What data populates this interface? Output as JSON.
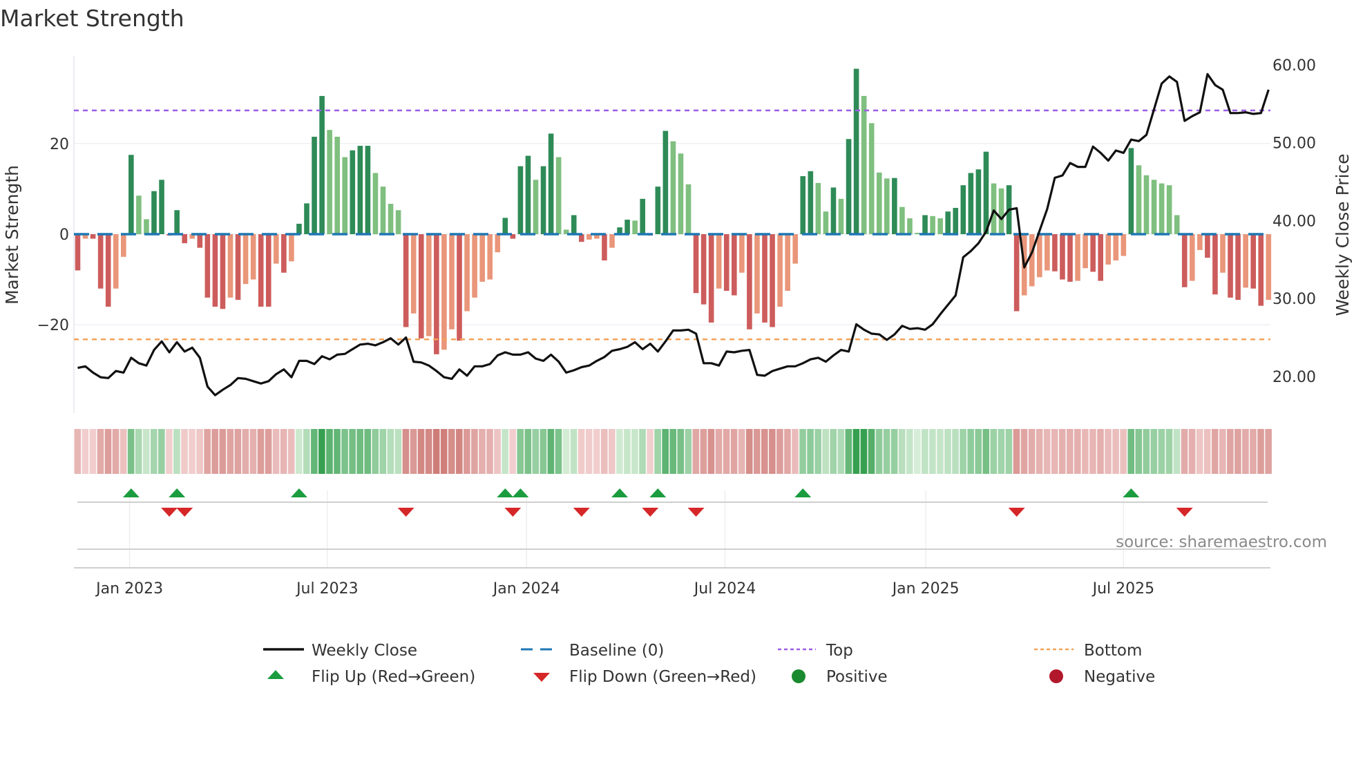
{
  "chart_data": {
    "type": "bar",
    "title": "Market Strength",
    "ylabel": "Market Strength",
    "y2label": "Weekly Close Price",
    "x_unit": "week index (weekly bars)",
    "ylim": [
      -39,
      40
    ],
    "y2lim": [
      15,
      65
    ],
    "yticks": [
      {
        "v": 20,
        "label": "20"
      },
      {
        "v": 0,
        "label": "0"
      },
      {
        "v": -20,
        "label": "−20"
      }
    ],
    "y2ticks": [
      {
        "v": 60,
        "label": "60.00"
      },
      {
        "v": 50,
        "label": "50.00"
      },
      {
        "v": 40,
        "label": "40.00"
      },
      {
        "v": 30,
        "label": "30.00"
      },
      {
        "v": 20,
        "label": "20.00"
      }
    ],
    "xticks": [
      {
        "w": 6.8,
        "label": "Jan 2023"
      },
      {
        "w": 32.7,
        "label": "Jul 2023"
      },
      {
        "w": 58.8,
        "label": "Jan 2024"
      },
      {
        "w": 84.8,
        "label": "Jul 2024"
      },
      {
        "w": 111.1,
        "label": "Jan 2025"
      },
      {
        "w": 137.0,
        "label": "Jul 2025"
      }
    ],
    "top_level": 27.3,
    "bottom_level": -23.2,
    "strength": [
      -8,
      -1,
      -1,
      -12,
      -16,
      -12,
      -5,
      17.5,
      8.5,
      3.3,
      9.5,
      12,
      -0.3,
      5.3,
      -2,
      -1,
      -3,
      -14,
      -16,
      -16.5,
      -14,
      -14.5,
      -11,
      -10,
      -16,
      -16,
      -6.5,
      -8.5,
      -6,
      2.3,
      6.8,
      21.5,
      30.5,
      23,
      21.5,
      17,
      18.5,
      19.5,
      19.5,
      13.5,
      10.5,
      6.7,
      5.3,
      -20.5,
      -17.5,
      -23,
      -22.5,
      -26.5,
      -25.5,
      -21,
      -23.5,
      -17,
      -14,
      -10.5,
      -10,
      -4,
      3.6,
      -1,
      15,
      17.3,
      12,
      15,
      22.2,
      17,
      1,
      4.2,
      -1.7,
      -1.2,
      -1,
      -5.8,
      -3,
      1.5,
      3.2,
      3,
      7.8,
      -0.3,
      10.5,
      22.8,
      20.5,
      17.8,
      11,
      -13,
      -15.5,
      -19.5,
      -12,
      -12.5,
      -13.5,
      -8.5,
      -21,
      -17.5,
      -19.5,
      -20.5,
      -16,
      -12.5,
      -6.5,
      12.8,
      13.9,
      11.3,
      5,
      10.3,
      7.8,
      21,
      36.5,
      30.5,
      24.5,
      13.6,
      12.3,
      12.4,
      6,
      3.5,
      0.3,
      4.2,
      4,
      3.5,
      5,
      5.8,
      10.8,
      13.5,
      14.3,
      18.2,
      11.2,
      10.1,
      10.8,
      -17,
      -13.5,
      -11.5,
      -9.5,
      -8,
      -8.2,
      -10,
      -10.5,
      -10.3,
      -7.5,
      -8.3,
      -10.3,
      -6.7,
      -5.8,
      -4.8,
      19,
      15.2,
      13,
      12,
      11.2,
      10.8,
      4.2,
      -11.7,
      -10.3,
      -3.5,
      -5.2,
      -13.3,
      -8.5,
      -14,
      -14.5,
      -11.8,
      -12,
      -15.8,
      -14.5
    ],
    "weekly_close": [
      21.1,
      21.3,
      20.5,
      19.9,
      19.8,
      20.7,
      20.5,
      22.4,
      21.7,
      21.4,
      23.4,
      24.5,
      23.1,
      24.4,
      23.2,
      23.7,
      22.4,
      18.7,
      17.6,
      18.3,
      18.9,
      19.8,
      19.7,
      19.4,
      19.1,
      19.4,
      20.3,
      20.9,
      19.9,
      22.0,
      22.0,
      21.6,
      22.6,
      22.2,
      22.8,
      22.9,
      23.5,
      24.1,
      24.2,
      24.0,
      24.4,
      24.9,
      24.1,
      25.0,
      21.9,
      21.8,
      21.4,
      20.7,
      19.9,
      19.7,
      20.9,
      20.1,
      21.3,
      21.3,
      21.6,
      22.7,
      23.1,
      22.8,
      22.8,
      23.1,
      22.3,
      22.0,
      22.8,
      21.9,
      20.5,
      20.8,
      21.2,
      21.4,
      22.0,
      22.5,
      23.3,
      23.5,
      23.8,
      24.4,
      23.5,
      24.2,
      23.2,
      24.5,
      25.9,
      25.9,
      26.0,
      25.5,
      21.7,
      21.7,
      21.4,
      23.2,
      23.1,
      23.3,
      23.4,
      20.2,
      20.1,
      20.7,
      21.0,
      21.3,
      21.3,
      21.7,
      22.2,
      22.4,
      21.9,
      22.7,
      23.4,
      23.2,
      26.7,
      26.0,
      25.5,
      25.4,
      24.7,
      25.4,
      26.5,
      26.1,
      26.2,
      26.0,
      26.7,
      28.0,
      29.2,
      30.4,
      35.3,
      36.1,
      37.1,
      38.6,
      41.3,
      40.2,
      41.4,
      41.6,
      34.0,
      35.9,
      38.7,
      41.5,
      45.5,
      45.8,
      47.4,
      46.9,
      46.9,
      49.5,
      48.7,
      47.7,
      49.0,
      48.7,
      50.4,
      50.2,
      51.0,
      54.3,
      57.6,
      58.5,
      57.8,
      52.8,
      53.4,
      53.9,
      58.8,
      57.4,
      56.8,
      53.8,
      53.8,
      53.9,
      53.7,
      53.8,
      56.8
    ],
    "flip_up_weeks": [
      7,
      13,
      29,
      56,
      58,
      71,
      76,
      95,
      138
    ],
    "flip_down_weeks": [
      12,
      14,
      43,
      57,
      66,
      75,
      81,
      123,
      145
    ],
    "legend": [
      {
        "label": "Weekly Close",
        "kind": "line"
      },
      {
        "label": "Baseline (0)",
        "kind": "dash"
      },
      {
        "label": "Top",
        "kind": "dot"
      },
      {
        "label": "Bottom",
        "kind": "dot"
      },
      {
        "label": "Flip Up (Red→Green)",
        "kind": "triangle-up"
      },
      {
        "label": "Flip Down (Green→Red)",
        "kind": "triangle-down"
      },
      {
        "label": "Positive",
        "kind": "circle"
      },
      {
        "label": "Negative",
        "kind": "circle"
      }
    ],
    "legend_placement": "bottom",
    "annotation": "source: sharemaestro.com"
  },
  "colors": {
    "pos_up": "#2e8b57",
    "pos_down": "#7fbf7f",
    "neg_down": "#cd5c5c",
    "neg_up": "#e9967a",
    "baseline": "#1f77b4",
    "top": "#9b5de5",
    "bottom": "#f4a259",
    "price": "#111111",
    "flip_up": "#1a9c3f",
    "flip_down": "#d62728",
    "positive": "#1a8a2e",
    "negative": "#b2182b"
  }
}
